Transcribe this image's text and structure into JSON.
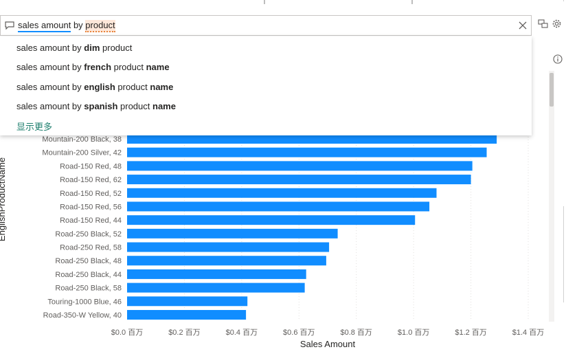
{
  "qa": {
    "query_part1": "sales amount",
    "query_part2": " by ",
    "query_part3": "product",
    "suggestions": [
      [
        {
          "t": "sales amount by ",
          "b": false
        },
        {
          "t": "dim",
          "b": true
        },
        {
          "t": " product",
          "b": false
        }
      ],
      [
        {
          "t": "sales amount by ",
          "b": false
        },
        {
          "t": "french",
          "b": true
        },
        {
          "t": " product ",
          "b": false
        },
        {
          "t": "name",
          "b": true
        }
      ],
      [
        {
          "t": "sales amount by ",
          "b": false
        },
        {
          "t": "english",
          "b": true
        },
        {
          "t": " product ",
          "b": false
        },
        {
          "t": "name",
          "b": true
        }
      ],
      [
        {
          "t": "sales amount by ",
          "b": false
        },
        {
          "t": "spanish",
          "b": true
        },
        {
          "t": " product ",
          "b": false
        },
        {
          "t": "name",
          "b": true
        }
      ]
    ],
    "show_more": "显示更多"
  },
  "icons": {
    "chat": "chat-bubble-icon",
    "clear": "close-icon",
    "convert": "convert-visual-icon",
    "settings": "gear-icon",
    "info": "info-icon"
  },
  "colors": {
    "bar": "#118dff",
    "accent": "#118dff",
    "show_more": "#1e7f6e"
  },
  "chart_data": {
    "type": "bar",
    "orientation": "horizontal",
    "categories": [
      "Mountain-200 Black, 38",
      "Mountain-200 Silver, 42",
      "Road-150 Red, 48",
      "Road-150 Red, 62",
      "Road-150 Red, 52",
      "Road-150 Red, 56",
      "Road-150 Red, 44",
      "Road-250 Black, 52",
      "Road-250 Red, 58",
      "Road-250 Black, 48",
      "Road-250 Black, 44",
      "Road-250 Black, 58",
      "Touring-1000 Blue, 46",
      "Road-350-W Yellow, 40"
    ],
    "values": [
      1.29,
      1.255,
      1.205,
      1.2,
      1.08,
      1.055,
      1.005,
      0.735,
      0.705,
      0.695,
      0.625,
      0.62,
      0.42,
      0.415
    ],
    "xlabel": "Sales Amount",
    "ylabel": "EnglishProductName",
    "xlim": [
      0,
      1.4
    ],
    "xticks": [
      0,
      0.2,
      0.4,
      0.6,
      0.8,
      1.0,
      1.2,
      1.4
    ],
    "xtick_labels": [
      "$0.0 百万",
      "$0.2 百万",
      "$0.4 百万",
      "$0.6 百万",
      "$0.8 百万",
      "$1.0 百万",
      "$1.2 百万",
      "$1.4 百万"
    ],
    "grid": "vertical-dotted"
  }
}
